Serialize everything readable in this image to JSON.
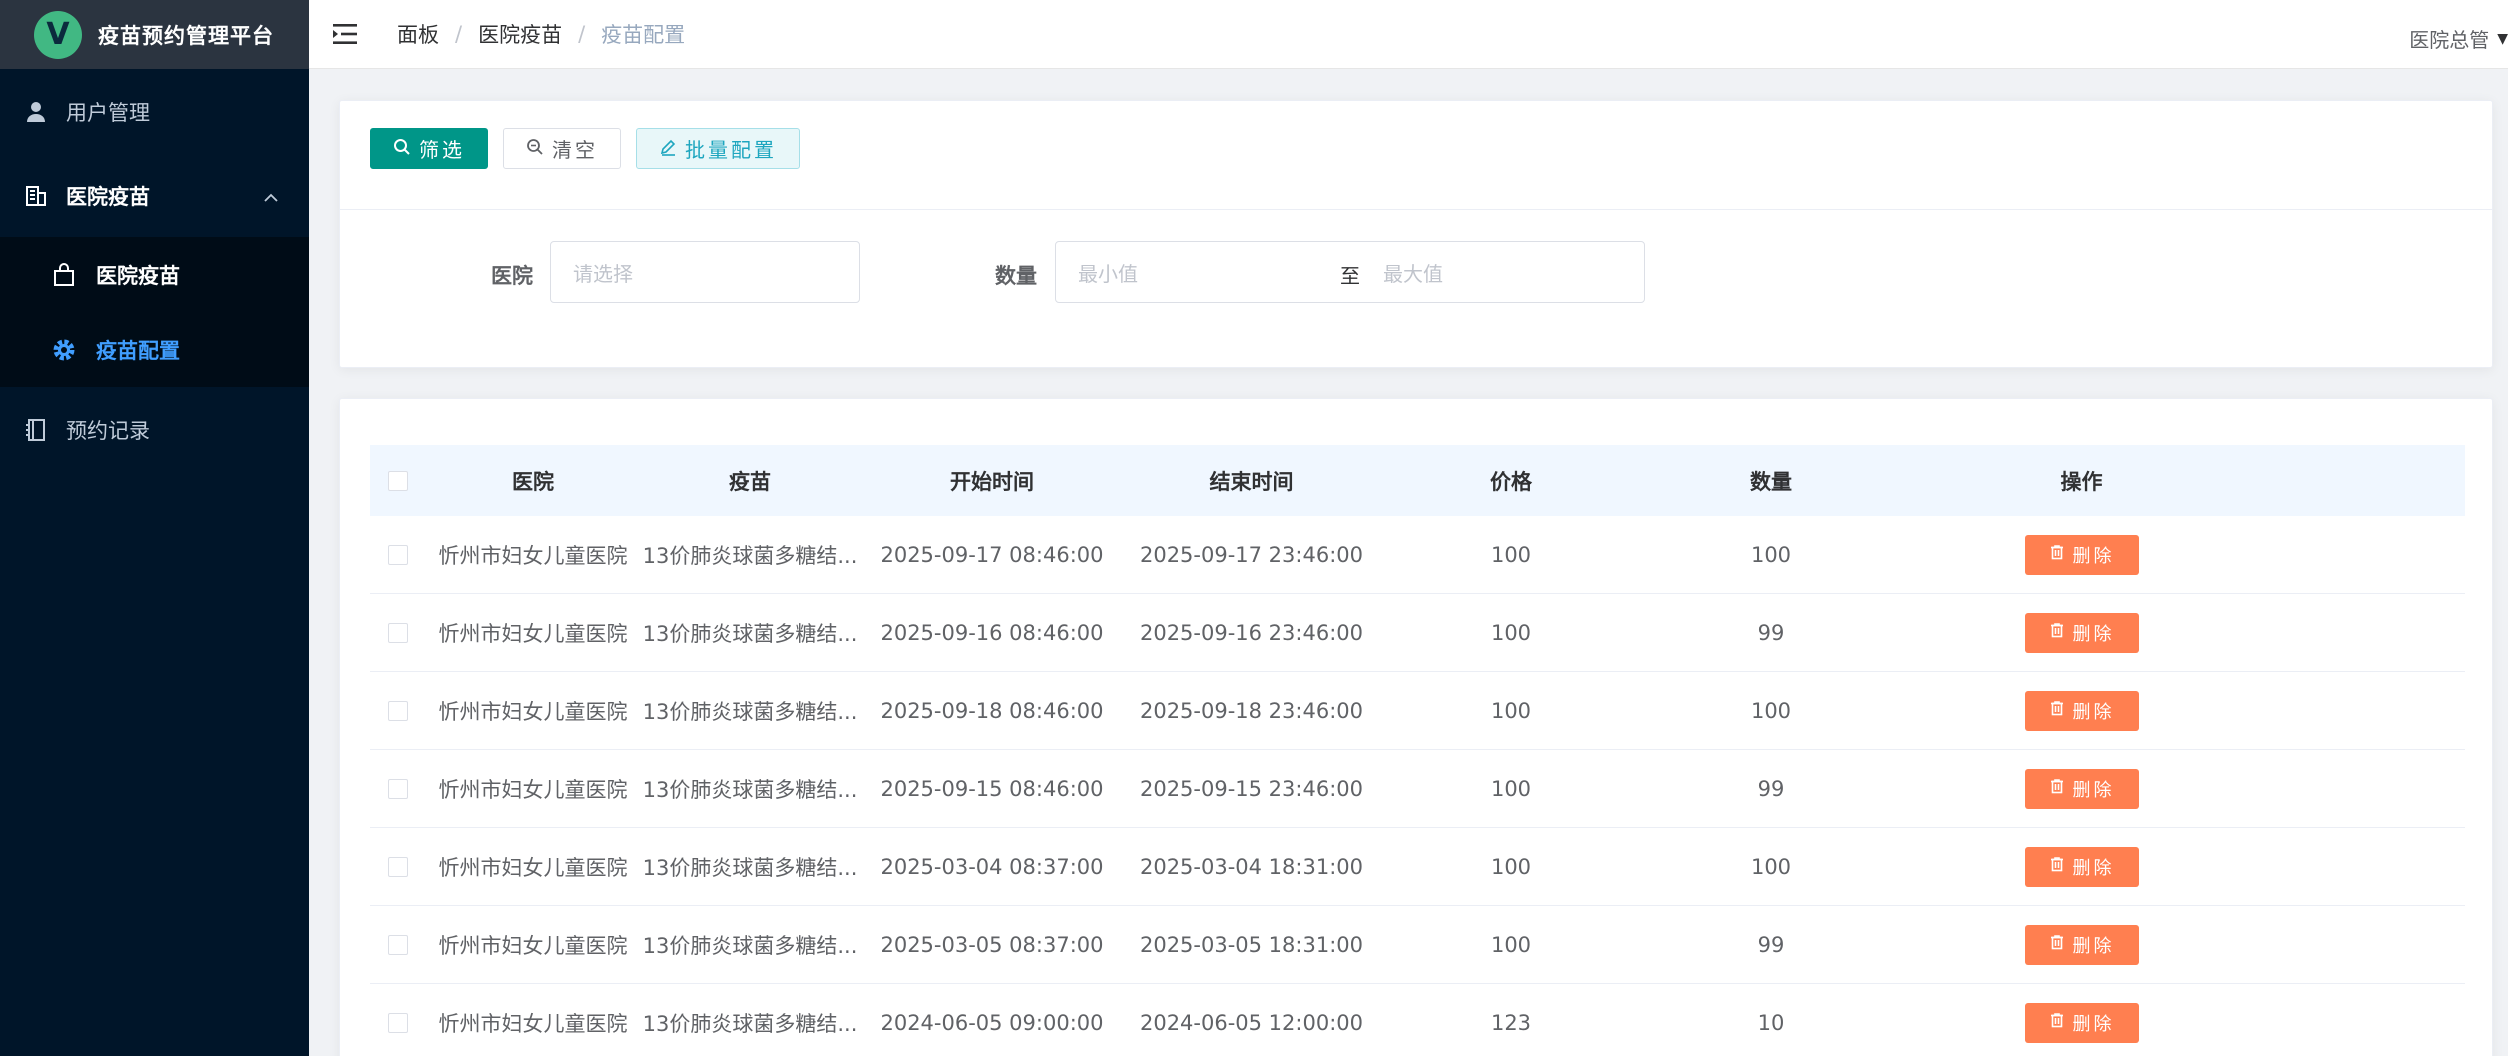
{
  "app": {
    "logo_letter": "V",
    "title": "疫苗预约管理平台",
    "user_name": "医院总管"
  },
  "sidebar": {
    "items": [
      {
        "label": "用户管理",
        "icon": "user-icon"
      },
      {
        "label": "医院疫苗",
        "icon": "building-icon",
        "expanded": true,
        "children": [
          {
            "label": "医院疫苗",
            "icon": "bag-icon"
          },
          {
            "label": "疫苗配置",
            "icon": "gear-icon",
            "active": true
          }
        ]
      },
      {
        "label": "预约记录",
        "icon": "notebook-icon"
      }
    ]
  },
  "breadcrumb": [
    "面板",
    "医院疫苗",
    "疫苗配置"
  ],
  "toolbar": {
    "filter_label": "筛选",
    "clear_label": "清空",
    "batch_label": "批量配置"
  },
  "filters": {
    "hospital_label": "医院",
    "hospital_placeholder": "请选择",
    "quantity_label": "数量",
    "min_placeholder": "最小值",
    "range_sep": "至",
    "max_placeholder": "最大值"
  },
  "table": {
    "columns": [
      "医院",
      "疫苗",
      "开始时间",
      "结束时间",
      "价格",
      "数量",
      "操作"
    ],
    "delete_label": "删除",
    "rows": [
      {
        "hospital": "忻州市妇女儿童医院",
        "vaccine": "13价肺炎球菌多糖结...",
        "start": "2025-09-17 08:46:00",
        "end": "2025-09-17 23:46:00",
        "price": "100",
        "qty": "100"
      },
      {
        "hospital": "忻州市妇女儿童医院",
        "vaccine": "13价肺炎球菌多糖结...",
        "start": "2025-09-16 08:46:00",
        "end": "2025-09-16 23:46:00",
        "price": "100",
        "qty": "99"
      },
      {
        "hospital": "忻州市妇女儿童医院",
        "vaccine": "13价肺炎球菌多糖结...",
        "start": "2025-09-18 08:46:00",
        "end": "2025-09-18 23:46:00",
        "price": "100",
        "qty": "100"
      },
      {
        "hospital": "忻州市妇女儿童医院",
        "vaccine": "13价肺炎球菌多糖结...",
        "start": "2025-09-15 08:46:00",
        "end": "2025-09-15 23:46:00",
        "price": "100",
        "qty": "99"
      },
      {
        "hospital": "忻州市妇女儿童医院",
        "vaccine": "13价肺炎球菌多糖结...",
        "start": "2025-03-04 08:37:00",
        "end": "2025-03-04 18:31:00",
        "price": "100",
        "qty": "100"
      },
      {
        "hospital": "忻州市妇女儿童医院",
        "vaccine": "13价肺炎球菌多糖结...",
        "start": "2025-03-05 08:37:00",
        "end": "2025-03-05 18:31:00",
        "price": "100",
        "qty": "99"
      },
      {
        "hospital": "忻州市妇女儿童医院",
        "vaccine": "13价肺炎球菌多糖结...",
        "start": "2024-06-05 09:00:00",
        "end": "2024-06-05 12:00:00",
        "price": "123",
        "qty": "10"
      }
    ]
  },
  "colors": {
    "sidebar_bg": "#001529",
    "primary": "#009688",
    "active_menu": "#409eff",
    "danger": "#ff7f50"
  }
}
